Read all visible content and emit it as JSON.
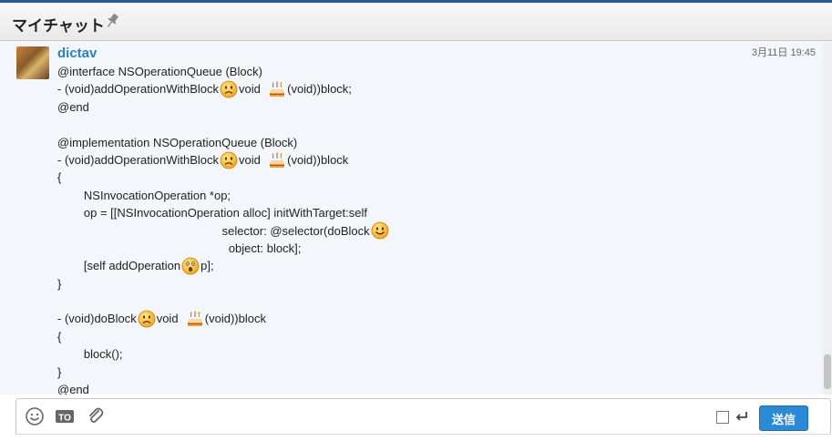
{
  "header": {
    "title": "マイチャット",
    "pin_icon": "pin-icon"
  },
  "message": {
    "username": "dictav",
    "timestamp": "3月11日 19:45",
    "lines": [
      [
        {
          "t": "@interface NSOperationQueue (Block)"
        }
      ],
      [
        {
          "t": "- (void)addOperationWithBlock"
        },
        {
          "e": "sad"
        },
        {
          "t": "void  "
        },
        {
          "e": "cake"
        },
        {
          "t": "(void))block;"
        }
      ],
      [
        {
          "t": "@end"
        }
      ],
      [
        {
          "t": ""
        }
      ],
      [
        {
          "t": "@implementation NSOperationQueue (Block)"
        }
      ],
      [
        {
          "t": "- (void)addOperationWithBlock"
        },
        {
          "e": "sad"
        },
        {
          "t": "void  "
        },
        {
          "e": "cake"
        },
        {
          "t": "(void))block"
        }
      ],
      [
        {
          "t": "{"
        }
      ],
      [
        {
          "t": "        NSInvocationOperation *op;"
        }
      ],
      [
        {
          "t": "        op = [[NSInvocationOperation alloc] initWithTarget:self"
        }
      ],
      [
        {
          "t": "                                                  selector: @selector(doBlock"
        },
        {
          "e": "smile"
        }
      ],
      [
        {
          "t": "                                                    object: block];"
        }
      ],
      [
        {
          "t": "        [self addOperation"
        },
        {
          "e": "surprised"
        },
        {
          "t": "p];"
        }
      ],
      [
        {
          "t": "}"
        }
      ],
      [
        {
          "t": ""
        }
      ],
      [
        {
          "t": "- (void)doBlock"
        },
        {
          "e": "sad"
        },
        {
          "t": "void  "
        },
        {
          "e": "cake"
        },
        {
          "t": "(void))block"
        }
      ],
      [
        {
          "t": "{"
        }
      ],
      [
        {
          "t": "        block();"
        }
      ],
      [
        {
          "t": "}"
        }
      ],
      [
        {
          "t": "@end"
        }
      ]
    ]
  },
  "toolbar": {
    "emoticon_icon": "smiley-icon",
    "to_label": "TO",
    "attach_icon": "paperclip-icon",
    "enter_icon": "enter-icon",
    "send_label": "送信"
  },
  "colors": {
    "accent": "#2a8ad6",
    "username": "#2d7fc0",
    "background": "#f3f6fb"
  }
}
